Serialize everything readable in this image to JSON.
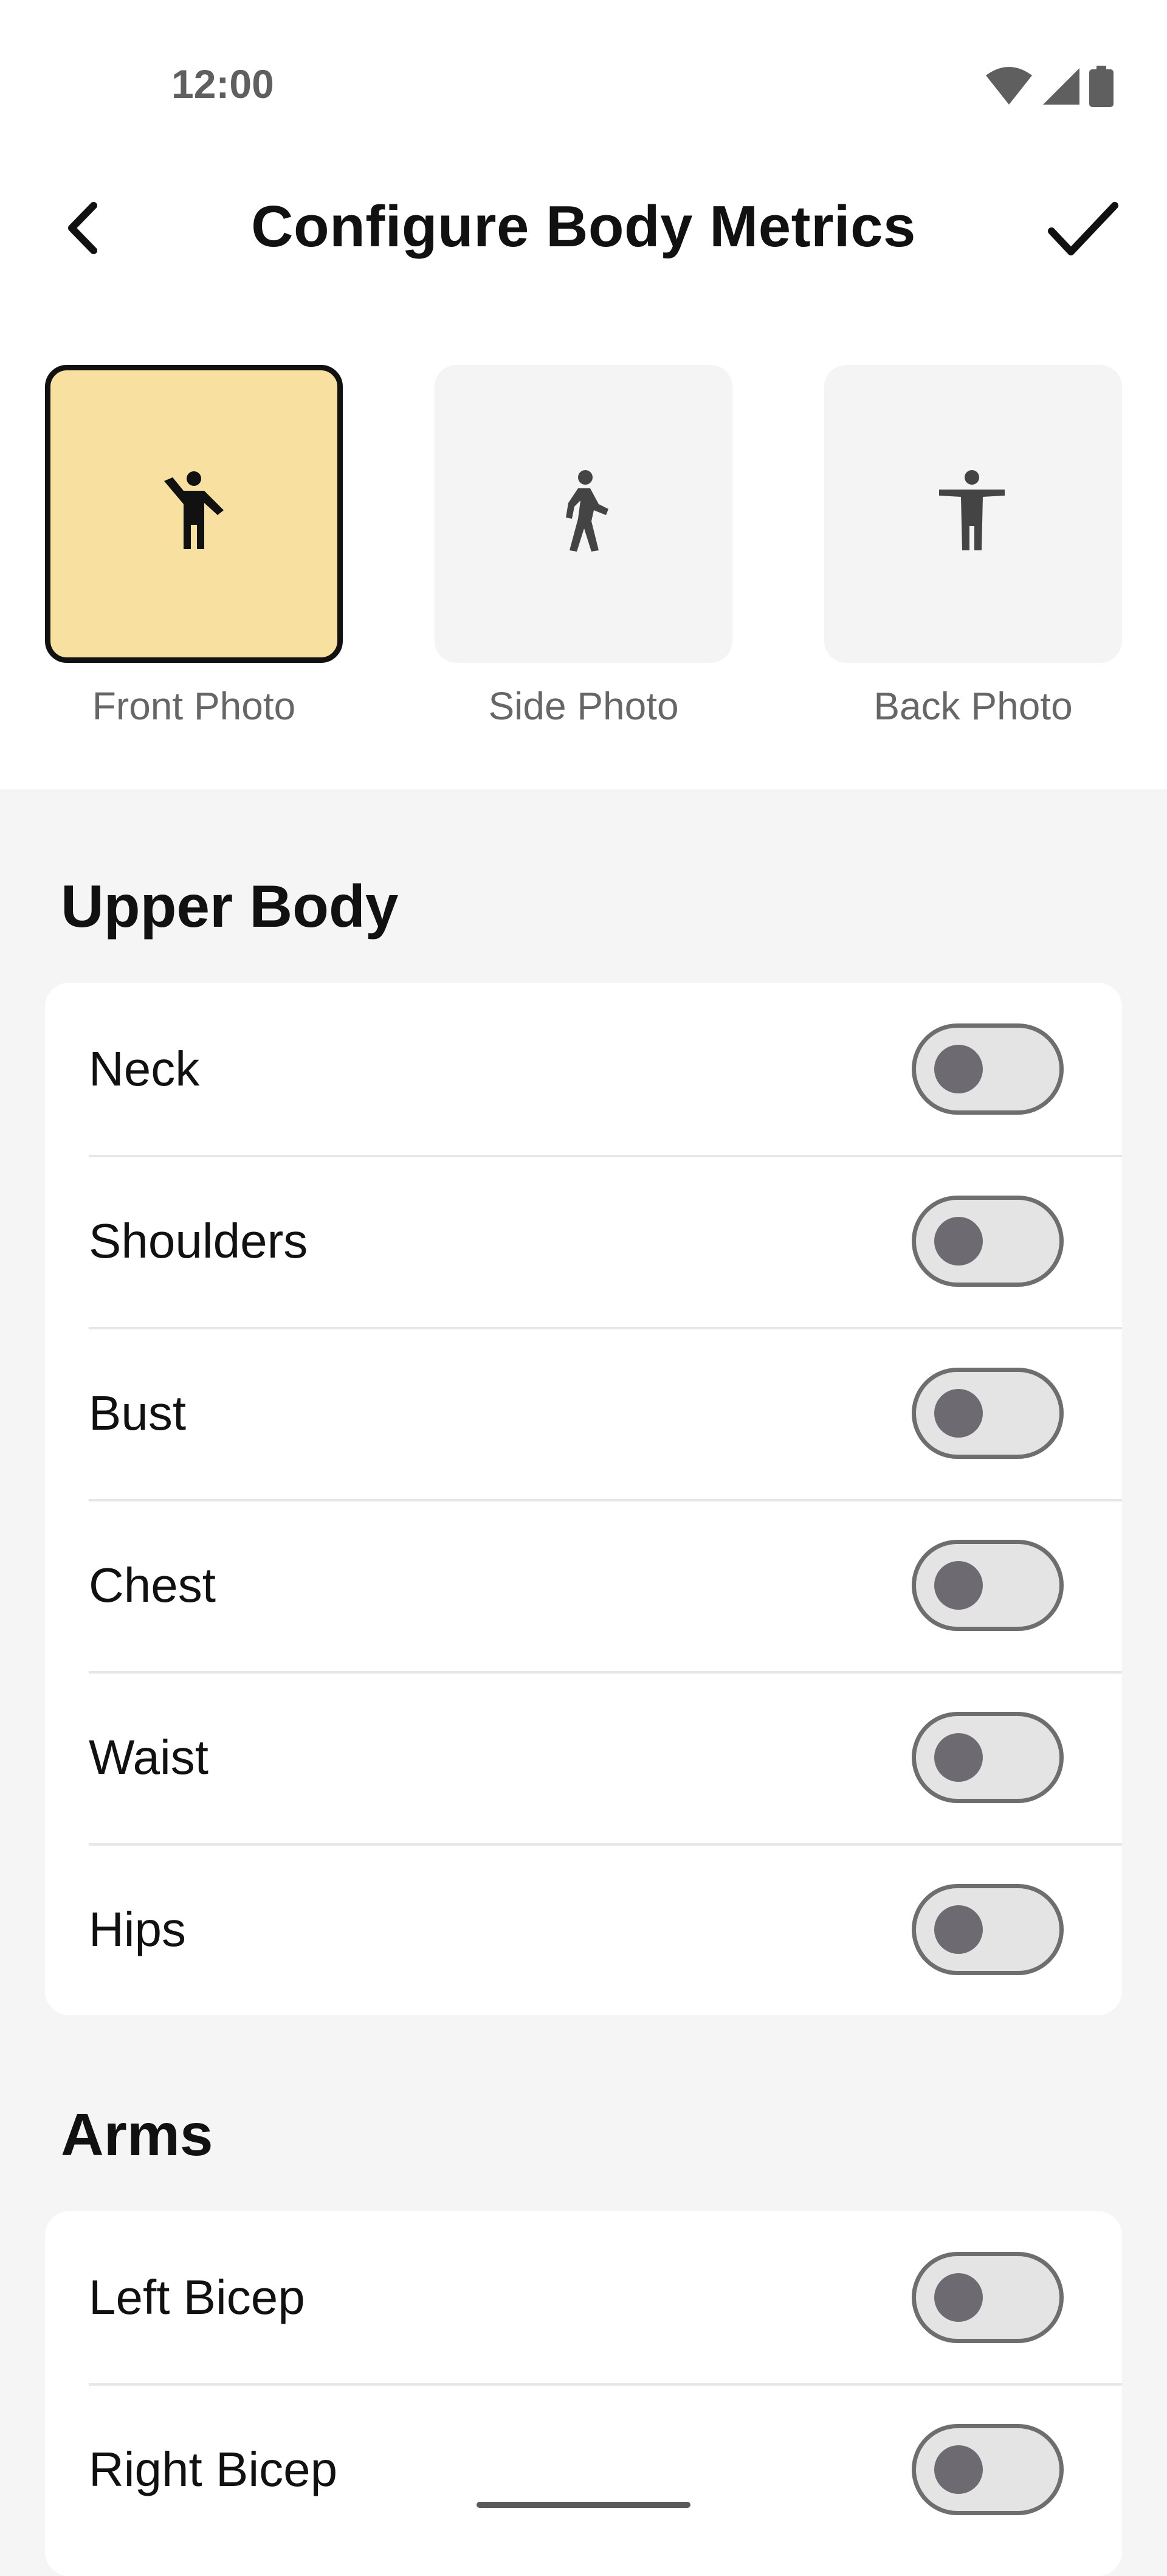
{
  "status_bar": {
    "time": "12:00",
    "icons": [
      "wifi-icon",
      "signal-icon",
      "battery-icon"
    ]
  },
  "app_bar": {
    "title": "Configure Body Metrics",
    "back_icon": "chevron-left-icon",
    "confirm_icon": "checkmark-icon"
  },
  "photos": [
    {
      "label": "Front Photo",
      "icon": "person-waving-icon",
      "selected": true
    },
    {
      "label": "Side Photo",
      "icon": "person-walking-icon",
      "selected": false
    },
    {
      "label": "Back Photo",
      "icon": "person-arms-out-icon",
      "selected": false
    }
  ],
  "sections": [
    {
      "title": "Upper Body",
      "items": [
        {
          "label": "Neck",
          "enabled": false
        },
        {
          "label": "Shoulders",
          "enabled": false
        },
        {
          "label": "Bust",
          "enabled": false
        },
        {
          "label": "Chest",
          "enabled": false
        },
        {
          "label": "Waist",
          "enabled": false
        },
        {
          "label": "Hips",
          "enabled": false
        }
      ]
    },
    {
      "title": "Arms",
      "items": [
        {
          "label": "Left Bicep",
          "enabled": false
        },
        {
          "label": "Right Bicep",
          "enabled": false
        }
      ]
    }
  ],
  "colors": {
    "selected_tile": "#f8e0a0",
    "tile": "#f4f4f4",
    "background": "#f5f5f5",
    "toggle_track": "#e4e4e4",
    "toggle_border": "#6e6e6e"
  }
}
